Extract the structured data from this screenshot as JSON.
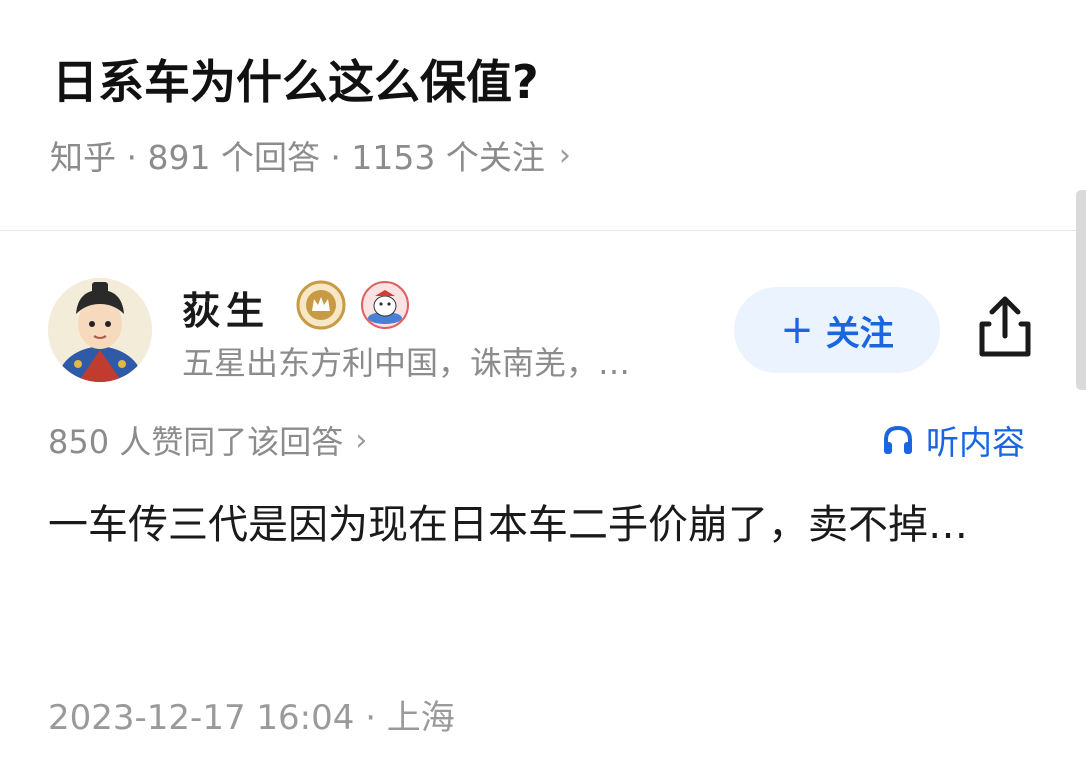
{
  "question": {
    "title": "日系车为什么这么保值?",
    "meta": "知乎 · 891 个回答 · 1153 个关注",
    "meta_chevron": "›"
  },
  "answer": {
    "author": {
      "name": "荻生",
      "bio": "五星出东方利中国，诛南羌，…",
      "badges": [
        "crown-badge-icon",
        "mascot-badge-icon"
      ]
    },
    "follow_label": "关注",
    "follow_plus": "+",
    "upvotes_text": "850 人赞同了该回答",
    "upvotes_chevron": "›",
    "listen_label": "听内容",
    "excerpt": "一车传三代是因为现在日本车二手价崩了，卖不掉…",
    "footer": "2023-12-17 16:04 · 上海"
  },
  "colors": {
    "accent": "#1966e0",
    "follow_bg": "#ebf3ff",
    "muted_text": "#8c8c8c",
    "badge_gold": "#c99a44"
  }
}
